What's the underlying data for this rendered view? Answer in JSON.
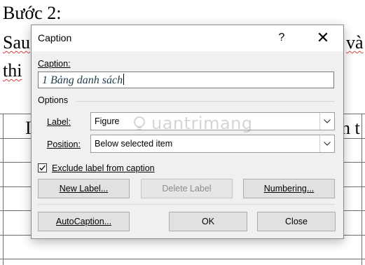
{
  "document": {
    "heading": "Bước 2:",
    "line1_left": "Sau",
    "line1_right": "và",
    "line2_left": "thi",
    "row_left": "I",
    "row_right": "n t"
  },
  "dialog": {
    "title": "Caption",
    "help": "?",
    "close_glyph": "✕",
    "caption_label": "Caption:",
    "caption_value": "1 Bảng danh sách",
    "options_label": "Options",
    "label_label": "Label:",
    "label_value": "Figure",
    "position_label": "Position:",
    "position_value": "Below selected item",
    "exclude_label": "Exclude label from caption",
    "exclude_checked": true,
    "buttons": {
      "new_label": "New Label...",
      "delete_label": "Delete Label",
      "numbering": "Numbering...",
      "autocaption": "AutoCaption...",
      "ok": "OK",
      "close": "Close"
    }
  },
  "watermark": "uantrimang",
  "colors": {
    "dialog_bg": "#f0f0f0",
    "button_bg": "#e1e1e1",
    "caption_text": "#24404f",
    "disabled_text": "#8c8c8c"
  }
}
